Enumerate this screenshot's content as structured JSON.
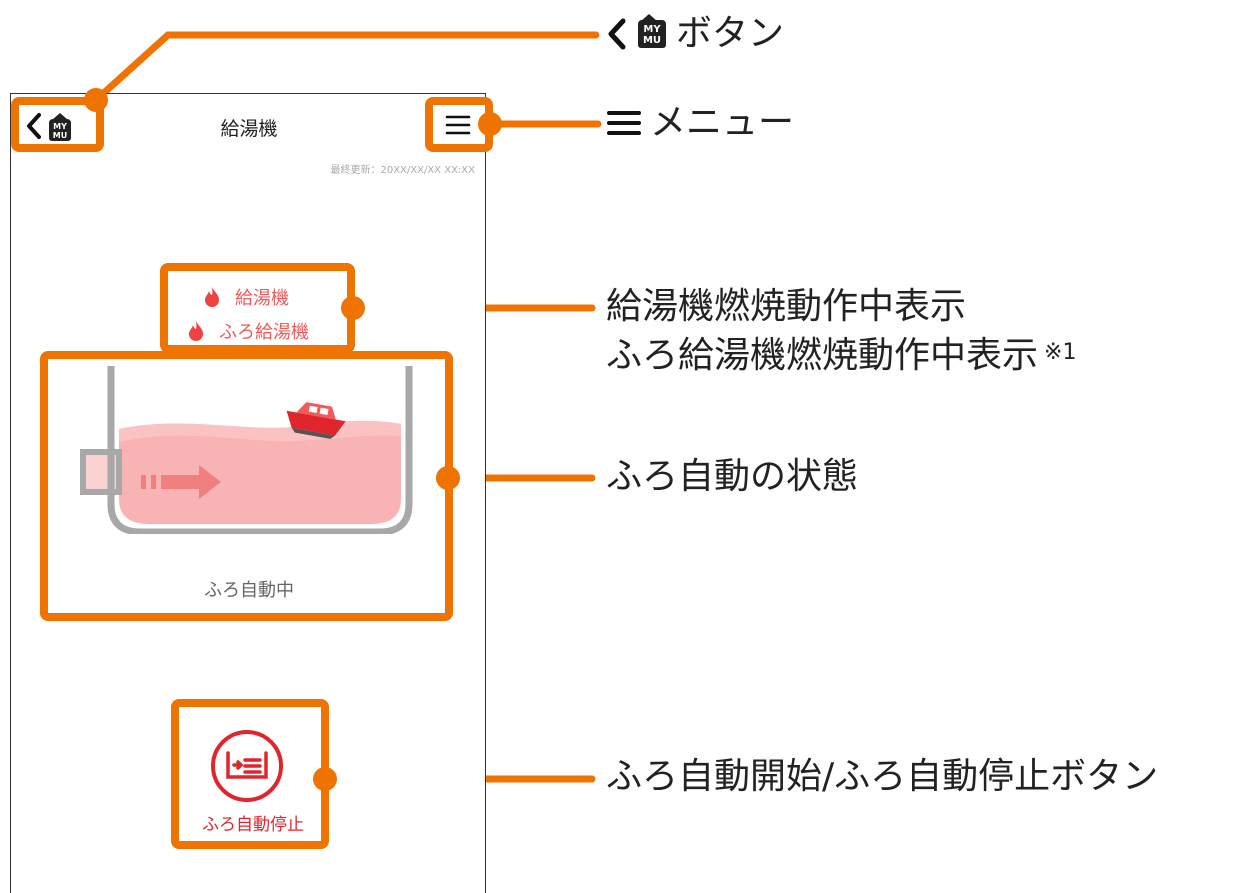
{
  "screen": {
    "title": "給湯機",
    "last_updated": "最終更新：20XX/XX/XX XX:XX",
    "back_button_badge_top": "MY",
    "back_button_badge_bottom": "MU",
    "burner_indicators": [
      {
        "label": "給湯機"
      },
      {
        "label": "ふろ給湯機"
      }
    ],
    "bath_status": "ふろ自動中",
    "bath_button_label": "ふろ自動停止"
  },
  "callouts": {
    "back_button": "ボタン",
    "back_badge_top": "MY",
    "back_badge_bottom": "MU",
    "menu": "メニュー",
    "burner_line1": "給湯機燃焼動作中表示",
    "burner_line2": "ふろ給湯機燃焼動作中表示",
    "burner_note": "※1",
    "bath_state": "ふろ自動の状態",
    "bath_button": "ふろ自動開始/ふろ自動停止ボタン"
  },
  "colors": {
    "highlight": "#ee7300",
    "accent_red": "#e0262d",
    "water": "#f8b4b4",
    "tub": "#a8a8a8"
  }
}
